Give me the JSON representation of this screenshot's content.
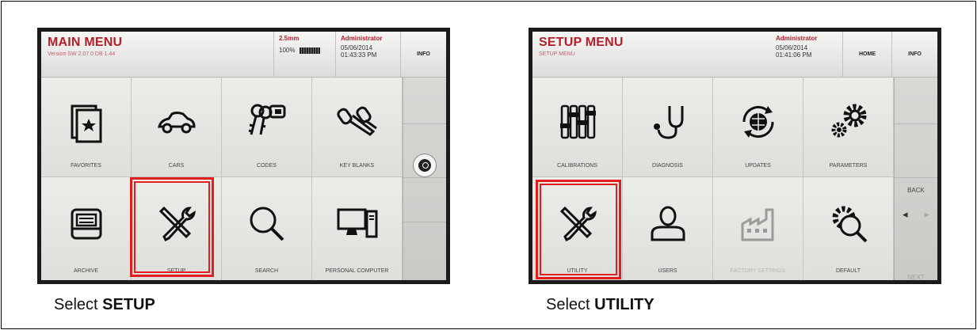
{
  "left_screen": {
    "title": "MAIN MENU",
    "subtitle": "Version SW 2.07.0 DB 1.44",
    "cutter": "2.5mm",
    "battery": "100%",
    "user": "Administrator",
    "date": "05/06/2014",
    "time": "01:43:33 PM",
    "info_label": "INFO",
    "tiles": [
      {
        "label": "FAVORITES",
        "icon": "favorites-icon"
      },
      {
        "label": "CARS",
        "icon": "car-icon"
      },
      {
        "label": "CODES",
        "icon": "keys-icon"
      },
      {
        "label": "KEY BLANKS",
        "icon": "key-blank-icon"
      },
      {
        "label": "ARCHIVE",
        "icon": "archive-icon"
      },
      {
        "label": "SETUP",
        "icon": "tools-icon"
      },
      {
        "label": "SEARCH",
        "icon": "search-icon"
      },
      {
        "label": "PERSONAL COMPUTER",
        "icon": "computer-icon"
      }
    ]
  },
  "right_screen": {
    "title": "SETUP MENU",
    "subtitle": "SETUP MENU",
    "user": "Administrator",
    "date": "05/06/2014",
    "time": "01:41:06 PM",
    "home_label": "HOME",
    "info_label": "INFO",
    "back_label": "BACK",
    "next_label": "NEXT",
    "tiles": [
      {
        "label": "CALIBRATIONS",
        "icon": "sliders-icon"
      },
      {
        "label": "DIAGNOSIS",
        "icon": "stethoscope-icon"
      },
      {
        "label": "UPDATES",
        "icon": "update-globe-icon"
      },
      {
        "label": "PARAMETERS",
        "icon": "gears-icon"
      },
      {
        "label": "UTILITY",
        "icon": "tools-icon"
      },
      {
        "label": "USERS",
        "icon": "user-icon"
      },
      {
        "label": "FACTORY SETTINGS",
        "icon": "factory-icon"
      },
      {
        "label": "DEFAULT",
        "icon": "gear-search-icon"
      }
    ]
  },
  "captions": {
    "left_prefix": "Select ",
    "left_bold": "SETUP",
    "right_prefix": "Select ",
    "right_bold": "UTILITY"
  },
  "colors": {
    "highlight": "#e11d1d",
    "title_red": "#b3202a"
  }
}
